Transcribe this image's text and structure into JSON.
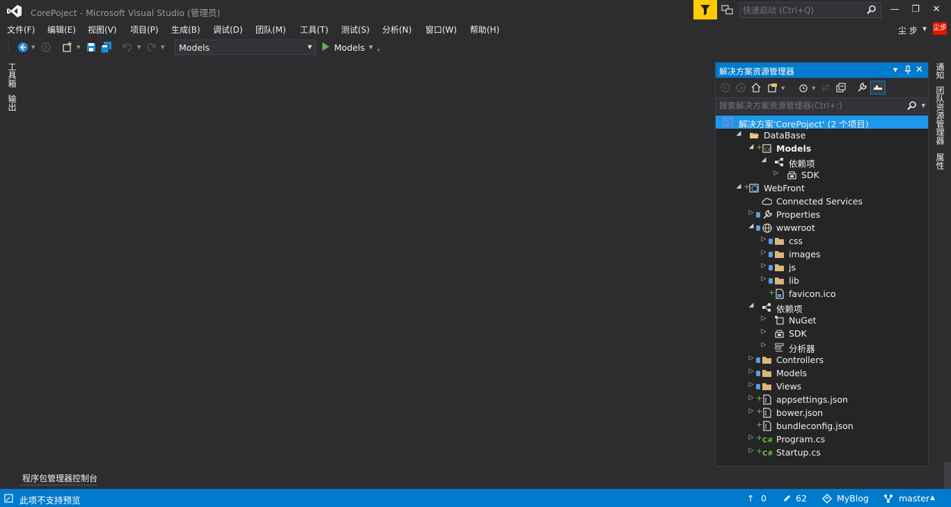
{
  "window": {
    "title": "CorePoject - Microsoft Visual Studio (管理员)",
    "quick_launch_placeholder": "快速启动 (Ctrl+Q)",
    "minimize": "—",
    "maximize": "❐",
    "close": "✕"
  },
  "menu": [
    "文件(F)",
    "编辑(E)",
    "视图(V)",
    "项目(P)",
    "生成(B)",
    "调试(D)",
    "团队(M)",
    "工具(T)",
    "测试(S)",
    "分析(N)",
    "窗口(W)",
    "帮助(H)"
  ],
  "user": {
    "name": "尘 步",
    "avatar_text": "尘步"
  },
  "toolbar": {
    "startup_project": "Models",
    "run_label": "Models"
  },
  "left_tabs": [
    "工具箱",
    "输出"
  ],
  "right_tabs": [
    "通知",
    "团队资源管理器",
    "属性"
  ],
  "solution_explorer": {
    "title": "解决方案资源管理器",
    "search_placeholder": "搜索解决方案资源管理器(Ctrl+;)",
    "items": [
      {
        "label": "解决方案'CorePoject' (2 个项目)",
        "level": 0,
        "expander": "",
        "icon": "solution-icon",
        "selected": true
      },
      {
        "label": "DataBase",
        "level": 1,
        "expander": "◢",
        "icon": "folder-open-icon"
      },
      {
        "label": "Models",
        "level": 2,
        "expander": "◢",
        "icon": "csharp-project-icon",
        "bold": true,
        "plus": true
      },
      {
        "label": "依赖项",
        "level": 3,
        "expander": "◢",
        "icon": "dependencies-icon"
      },
      {
        "label": "SDK",
        "level": 4,
        "expander": "▷",
        "icon": "sdk-icon"
      },
      {
        "label": "WebFront",
        "level": 1,
        "expander": "◢",
        "icon": "web-project-icon",
        "plus": true
      },
      {
        "label": "Connected Services",
        "level": 2,
        "expander": "",
        "icon": "cloud-icon"
      },
      {
        "label": "Properties",
        "level": 2,
        "expander": "▷",
        "icon": "wrench-icon",
        "lock": true
      },
      {
        "label": "wwwroot",
        "level": 2,
        "expander": "◢",
        "icon": "globe-icon",
        "lock": true
      },
      {
        "label": "css",
        "level": 3,
        "expander": "▷",
        "icon": "folder-icon",
        "lock": true
      },
      {
        "label": "images",
        "level": 3,
        "expander": "▷",
        "icon": "folder-icon",
        "lock": true
      },
      {
        "label": "js",
        "level": 3,
        "expander": "▷",
        "icon": "folder-icon",
        "lock": true
      },
      {
        "label": "lib",
        "level": 3,
        "expander": "▷",
        "icon": "folder-icon",
        "lock": true
      },
      {
        "label": "favicon.ico",
        "level": 3,
        "expander": "",
        "icon": "file-icon",
        "plus": true
      },
      {
        "label": "依赖项",
        "level": 2,
        "expander": "◢",
        "icon": "dependencies-icon"
      },
      {
        "label": "NuGet",
        "level": 3,
        "expander": "▷",
        "icon": "nuget-icon"
      },
      {
        "label": "SDK",
        "level": 3,
        "expander": "▷",
        "icon": "sdk-icon"
      },
      {
        "label": "分析器",
        "level": 3,
        "expander": "▷",
        "icon": "analyzer-icon"
      },
      {
        "label": "Controllers",
        "level": 2,
        "expander": "▷",
        "icon": "folder-icon",
        "lock": true
      },
      {
        "label": "Models",
        "level": 2,
        "expander": "▷",
        "icon": "folder-icon",
        "lock": true
      },
      {
        "label": "Views",
        "level": 2,
        "expander": "▷",
        "icon": "folder-icon",
        "lock": true
      },
      {
        "label": "appsettings.json",
        "level": 2,
        "expander": "▷",
        "icon": "json-icon",
        "plus": true
      },
      {
        "label": "bower.json",
        "level": 2,
        "expander": "▷",
        "icon": "json-icon",
        "plus": true
      },
      {
        "label": "bundleconfig.json",
        "level": 2,
        "expander": "",
        "icon": "json-icon",
        "plus": true
      },
      {
        "label": "Program.cs",
        "level": 2,
        "expander": "▷",
        "icon": "csharp-file-icon",
        "plus": true
      },
      {
        "label": "Startup.cs",
        "level": 2,
        "expander": "▷",
        "icon": "csharp-file-icon",
        "plus": true
      }
    ]
  },
  "bottom_tab": "程序包管理器控制台",
  "status": {
    "message": "此项不支持预览",
    "push_count": "0",
    "changes_count": "62",
    "repo": "MyBlog",
    "branch": "master"
  },
  "colors": {
    "accent": "#007acc",
    "notify": "#ffcc00",
    "avatar": "#e51400"
  }
}
